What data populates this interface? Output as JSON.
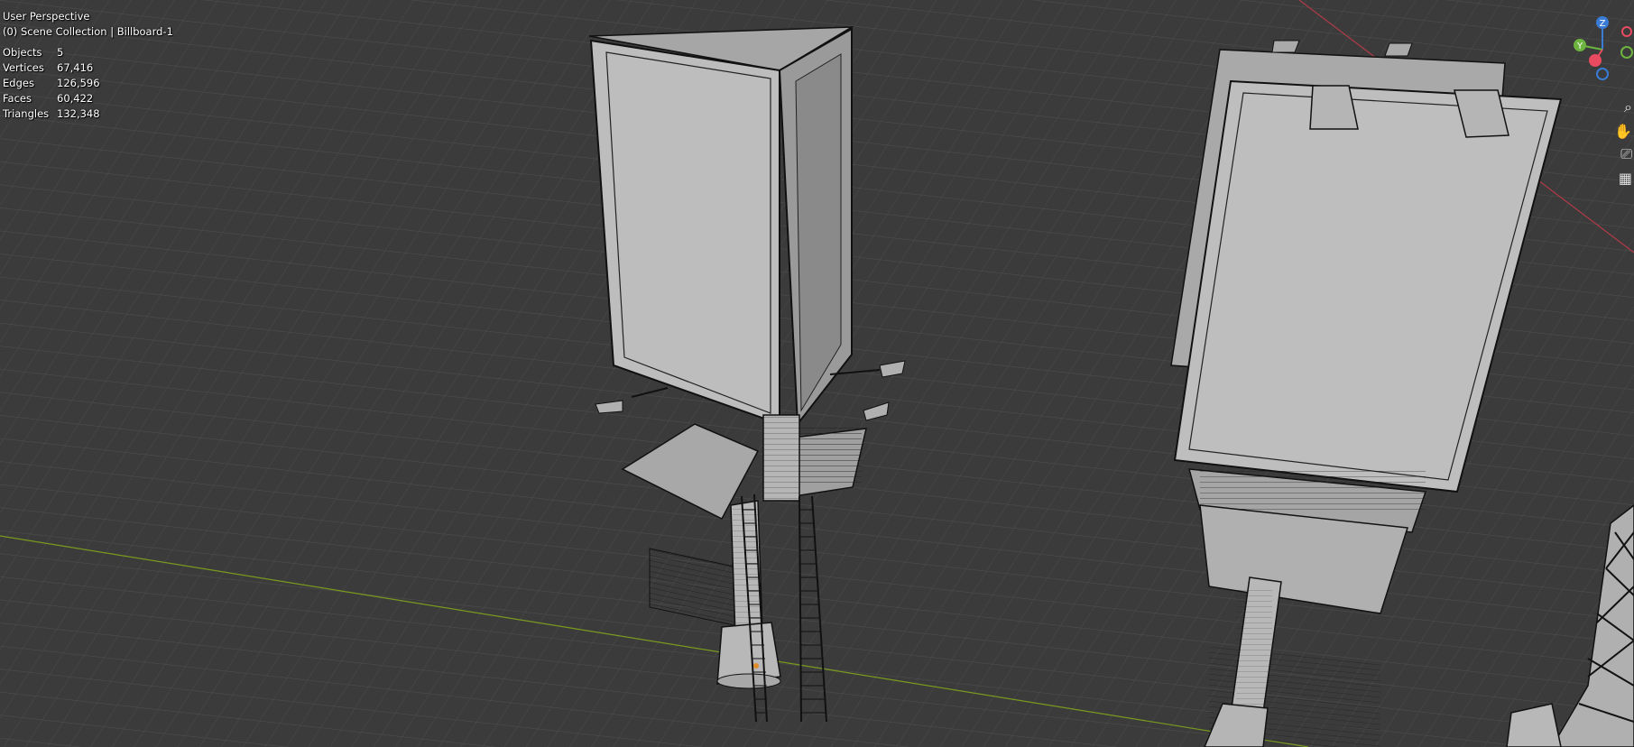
{
  "viewport": {
    "title": "User Perspective",
    "collection": "(0) Scene Collection | Billboard-1"
  },
  "stats": [
    {
      "label": "Objects",
      "value": "5"
    },
    {
      "label": "Vertices",
      "value": "67,416"
    },
    {
      "label": "Edges",
      "value": "126,596"
    },
    {
      "label": "Faces",
      "value": "60,422"
    },
    {
      "label": "Triangles",
      "value": "132,348"
    }
  ],
  "gizmo": {
    "z_label": "Z",
    "y_label": "Y",
    "x_color": "#e84a5f",
    "y_color": "#6db33f",
    "z_color": "#3a7bd5"
  },
  "nav_tools": [
    "zoom-icon",
    "hand-pan-icon",
    "camera-icon",
    "grid-perspective-icon"
  ],
  "colors": {
    "background": "#3c3c3c",
    "grid_line": "#505050",
    "x_axis": "#b23a48",
    "y_axis": "#7a9a1f",
    "model_face": "#bcbcbc",
    "model_edge": "#111111"
  }
}
